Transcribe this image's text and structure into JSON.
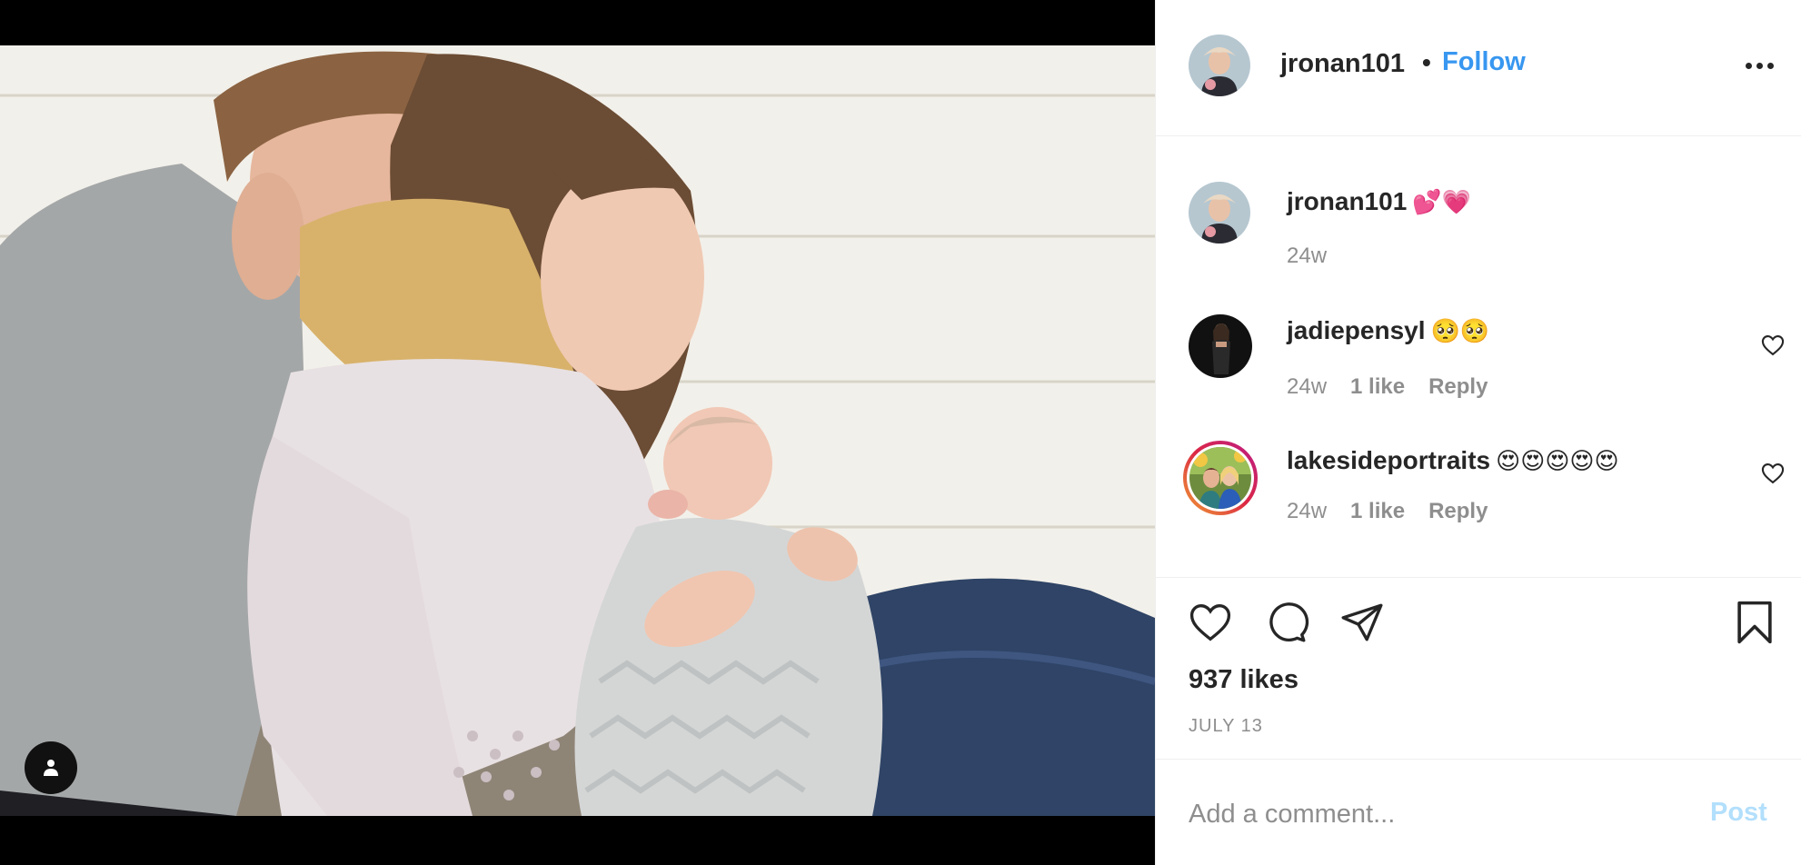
{
  "post": {
    "author": "jronan101",
    "follow_label": "Follow",
    "separator": "•",
    "caption": {
      "username": "jronan101",
      "text": "💕💗",
      "time": "24w"
    },
    "comments": [
      {
        "username": "jadiepensyl",
        "text": "🥺🥺",
        "time": "24w",
        "likes": "1 like",
        "reply_label": "Reply"
      },
      {
        "username": "lakesideportraits",
        "text": "😍😍😍😍😍",
        "time": "24w",
        "likes": "1 like",
        "reply_label": "Reply"
      }
    ],
    "likes_count": "937 likes",
    "date": "JULY 13"
  },
  "composer": {
    "placeholder": "Add a comment...",
    "post_label": "Post"
  },
  "colors": {
    "link_blue": "#3897f0",
    "post_disabled": "#b2dffc",
    "muted_text": "#8e8e8e",
    "primary_text": "#262626",
    "story_ring_start": "#f09433",
    "story_ring_end": "#bc1888"
  },
  "icons": {
    "more": "more-options-icon",
    "like": "heart-icon",
    "comment": "comment-icon",
    "share": "share-icon",
    "save": "bookmark-icon",
    "tag": "user-tag-icon"
  }
}
